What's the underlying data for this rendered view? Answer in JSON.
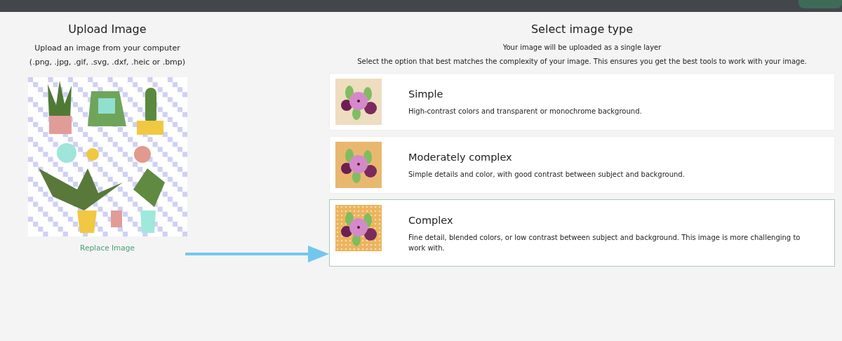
{
  "upload": {
    "title": "Upload Image",
    "subtitle": "Upload an image from your computer",
    "formats": "(.png, .jpg, .gif, .svg, .dxf, .heic or .bmp)",
    "replace_link": "Replace Image"
  },
  "select": {
    "title": "Select image type",
    "note": "Your image will be uploaded as a single layer",
    "instruction": "Select the option that best matches the complexity of your image. This ensures you get the best tools to work with your image.",
    "options": [
      {
        "title": "Simple",
        "description": "High-contrast colors and transparent or monochrome background.",
        "color": "#eeddbf",
        "patterned": false,
        "selected": false
      },
      {
        "title": "Moderately complex",
        "description": "Simple details and color, with good contrast between subject and background.",
        "color": "#e9b870",
        "patterned": false,
        "selected": false
      },
      {
        "title": "Complex",
        "description": "Fine detail, blended colors, or low contrast between subject and background. This image is more challenging to work with.",
        "color": "#ecb45e",
        "patterned": true,
        "selected": true
      }
    ]
  }
}
